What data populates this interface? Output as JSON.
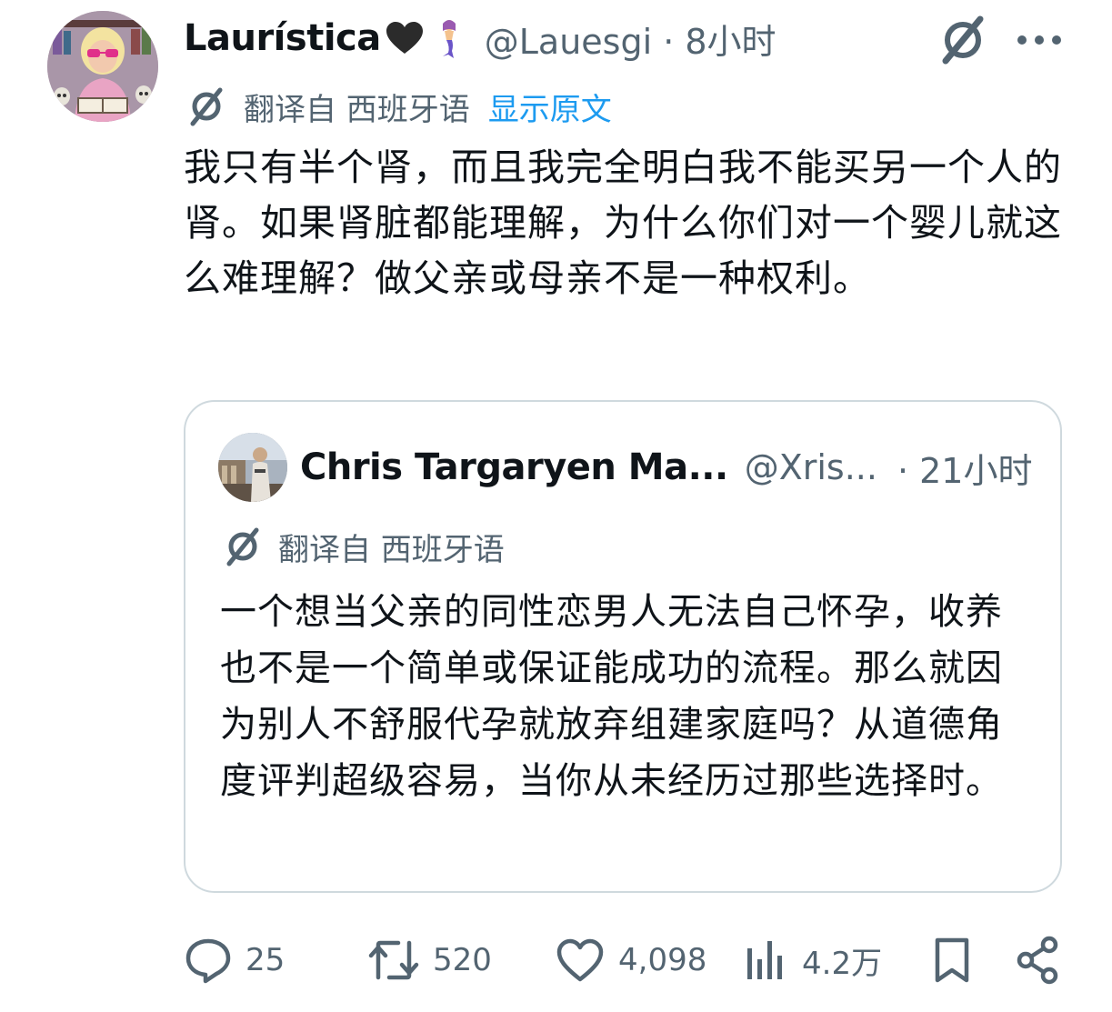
{
  "post": {
    "author_name": "Laurística",
    "author_heart": "black-heart-emoji",
    "author_emoji": "mermaid-emoji",
    "handle_time": "@Lauesgi · 8小时",
    "translated_label": "翻译自 西班牙语",
    "show_original": "显示原文",
    "text": "我只有半个肾，而且我完全明白我不能买另一个人的肾。如果肾脏都能理解，为什么你们对一个婴儿就这么难理解？做父亲或母亲不是一种权利。"
  },
  "quote": {
    "author_name": "Chris Targaryen Ma...",
    "handle": "@Xris...",
    "time": "· 21小时",
    "translated_label": "翻译自 西班牙语",
    "text": "一个想当父亲的同性恋男人无法自己怀孕，收养也不是一个简单或保证能成功的流程。那么就因为别人不舒服代孕就放弃组建家庭吗？从道德角度评判超级容易，当你从未经历过那些选择时。"
  },
  "actions": {
    "replies": "25",
    "reposts": "520",
    "likes": "4,098",
    "views": "4.2万"
  },
  "colors": {
    "text": "#0f1419",
    "secondary": "#536471",
    "link": "#1d9bf0",
    "border": "#cfd9de"
  }
}
